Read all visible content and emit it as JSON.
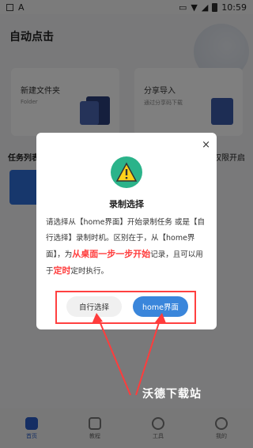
{
  "statusbar": {
    "time": "10:59",
    "left_a": "▣",
    "left_b": "A"
  },
  "app": {
    "title": "自动点击"
  },
  "cards": [
    {
      "title": "新建文件夹",
      "subtitle": "Folder"
    },
    {
      "title": "分享导入",
      "subtitle": "通过分享码下载"
    }
  ],
  "section": {
    "task_list": "任务列表",
    "permission": "权限开启"
  },
  "tabs": [
    {
      "label": "首页",
      "icon": "home-icon"
    },
    {
      "label": "教程",
      "icon": "book-icon"
    },
    {
      "label": "工具",
      "icon": "tools-icon"
    },
    {
      "label": "我的",
      "icon": "profile-icon"
    }
  ],
  "dialog": {
    "close": "×",
    "title": "录制选择",
    "body_part1": "请选择从【home界面】开始录制任务 或是【自行选择】录制时机。区别在于，从【home界面】，为",
    "body_emph1": "从桌面一步一步开始",
    "body_part2": "记录，且可以用于",
    "body_emph2": "定时",
    "body_part3": "定时执行。",
    "btn_self": "自行选择",
    "btn_home": "home界面",
    "warn_color": "#2bb38a",
    "accent_color": "#3a86db",
    "highlight_color": "#ff3c3c"
  },
  "watermark": "沃德下载站"
}
